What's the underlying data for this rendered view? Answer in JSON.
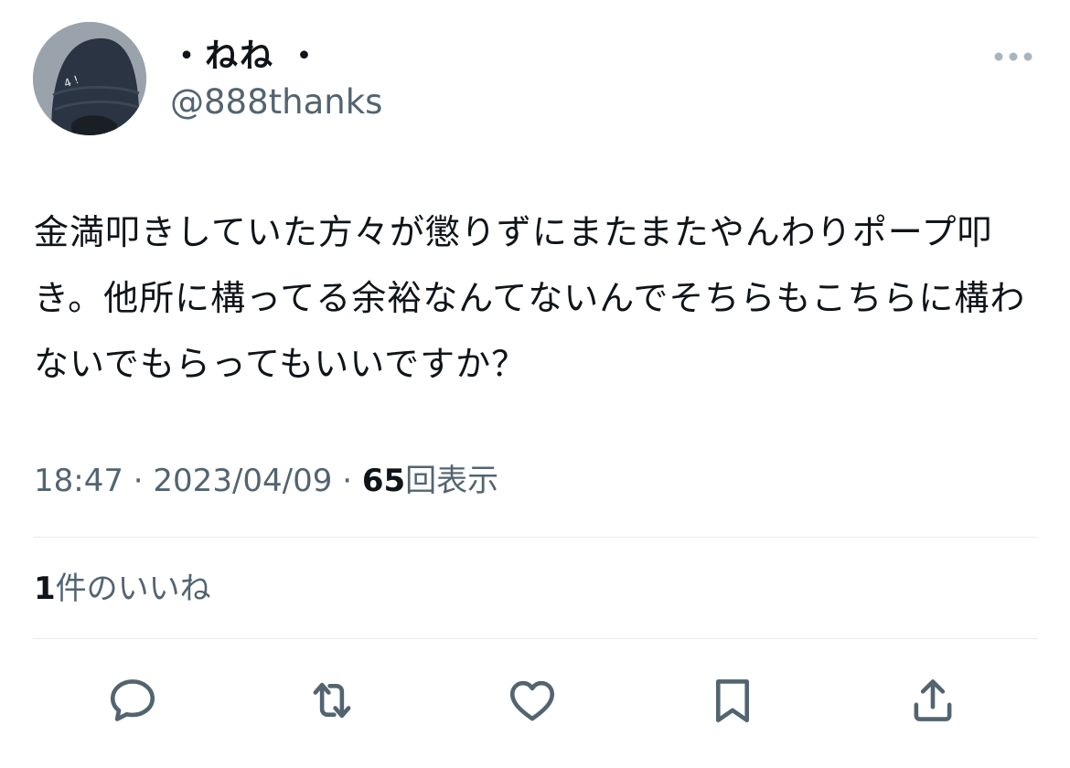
{
  "tweet": {
    "display_name": "・ねね ・",
    "handle": "@888thanks",
    "text": "金満叩きしていた方々が懲りずにまたまたやんわりポープ叩き。他所に構ってる余裕なんてないんでそちらもこちらに構わないでもらってもいいですか？",
    "time": "18:47",
    "separator": "·",
    "date": "2023/04/09",
    "views_count": "65",
    "views_label": "回表示",
    "likes_count": "1",
    "likes_label": "件のいいね"
  },
  "icons": {
    "more": "more-dots-icon",
    "reply": "reply-icon",
    "retweet": "retweet-icon",
    "like": "heart-icon",
    "bookmark": "bookmark-icon",
    "share": "share-icon"
  },
  "colors": {
    "text_primary": "#0f1419",
    "text_secondary": "#536471",
    "icon": "#536471",
    "divider": "#e6e9ec",
    "background": "#ffffff"
  }
}
